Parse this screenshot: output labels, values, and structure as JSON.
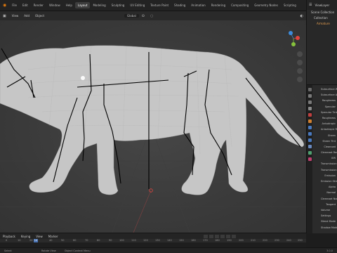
{
  "topbar": {
    "logo": "Blender",
    "menus": [
      "File",
      "Edit",
      "Render",
      "Window",
      "Help"
    ],
    "workspaces": [
      "Layout",
      "Modeling",
      "Sculpting",
      "UV Editing",
      "Texture Paint",
      "Shading",
      "Animation",
      "Rendering",
      "Compositing",
      "Geometry Nodes",
      "Scripting"
    ],
    "active_workspace": "Layout",
    "scene": "Scene",
    "view_layer": "ViewLayer"
  },
  "viewport_header": {
    "menus": [
      "View",
      "Add",
      "Object"
    ],
    "orientation": "Global"
  },
  "outliner": {
    "rows": [
      "Scene Collection",
      "Collection",
      "Armature"
    ]
  },
  "properties": {
    "rows": [
      "Subsurface Wei...",
      "Subsurface Ani...",
      "Roughness",
      "Specular",
      "Specular Tint",
      "Roughness",
      "Anisotropic",
      "Anisotropic Rota...",
      "Sheen",
      "Sheen Tint",
      "Clearcoat",
      "Clearcoat Rough...",
      "IOR",
      "Transmission",
      "Transmission Ro...",
      "Emission",
      "Emission Strength",
      "Alpha",
      "Normal",
      "Clearcoat Normal",
      "Tangent",
      "Volume",
      "Settings",
      "Blend Mode",
      "Shadow Mode"
    ]
  },
  "timeline": {
    "menus": [
      "Playback",
      "Keying",
      "View",
      "Marker"
    ],
    "current_frame": "14",
    "ticks": [
      "0",
      "10",
      "20",
      "30",
      "40",
      "50",
      "60",
      "70",
      "80",
      "90",
      "100",
      "110",
      "120",
      "130",
      "140",
      "150",
      "160",
      "170",
      "180",
      "190",
      "200",
      "210",
      "220",
      "230",
      "240",
      "250"
    ]
  },
  "statusbar": {
    "left": "Select",
    "mid1": "Rotate View",
    "mid2": "Object Context Menu",
    "version": "3.0.0"
  },
  "colors": {
    "accent": "#4772b3",
    "mesh": "#c9c9c9",
    "bones": "#000000",
    "x_axis": "#e0443e",
    "y_axis": "#86c23c",
    "z_axis": "#3d8bdb"
  }
}
